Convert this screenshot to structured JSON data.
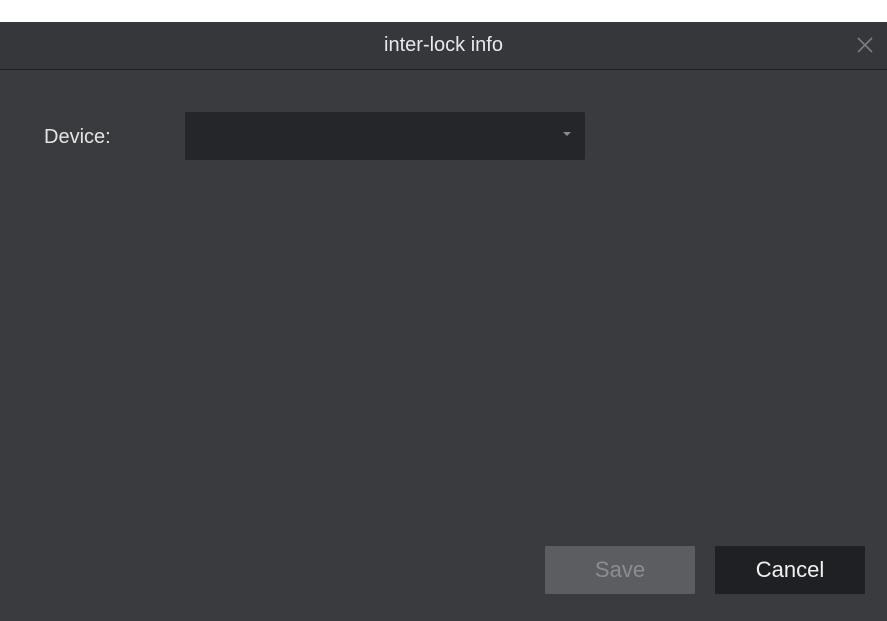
{
  "dialog": {
    "title": "inter-lock info",
    "close_icon": "close-icon"
  },
  "form": {
    "device_label": "Device:",
    "device_value": "",
    "device_arrow_icon": "chevron-down-icon"
  },
  "footer": {
    "save_label": "Save",
    "save_enabled": false,
    "cancel_label": "Cancel"
  },
  "colors": {
    "dialog_bg": "#3a3b3f",
    "select_bg": "#252629",
    "save_disabled_bg": "#5c5d61",
    "cancel_bg": "#1f2023"
  }
}
